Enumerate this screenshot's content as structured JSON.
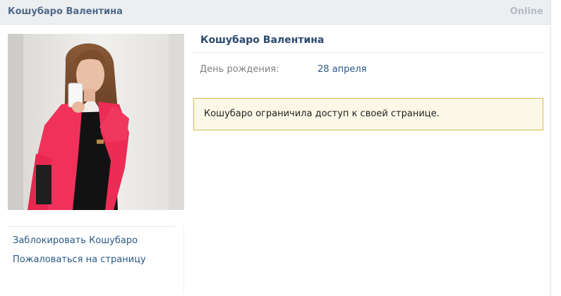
{
  "header": {
    "user_name": "Кошубаро Валентина",
    "status": "Online"
  },
  "profile": {
    "name": "Кошубаро Валентина",
    "birthday_label": "День рождения:",
    "birthday_value": "28 апреля",
    "notice": "Кошубаро ограничила доступ к своей странице."
  },
  "actions": {
    "block": "Заблокировать Кошубаро",
    "report": "Пожаловаться на страницу"
  },
  "colors": {
    "link": "#2a5885",
    "header_bg": "#edeef0",
    "notice_bg": "#fbf8e8",
    "notice_border": "#d4bc4c"
  }
}
